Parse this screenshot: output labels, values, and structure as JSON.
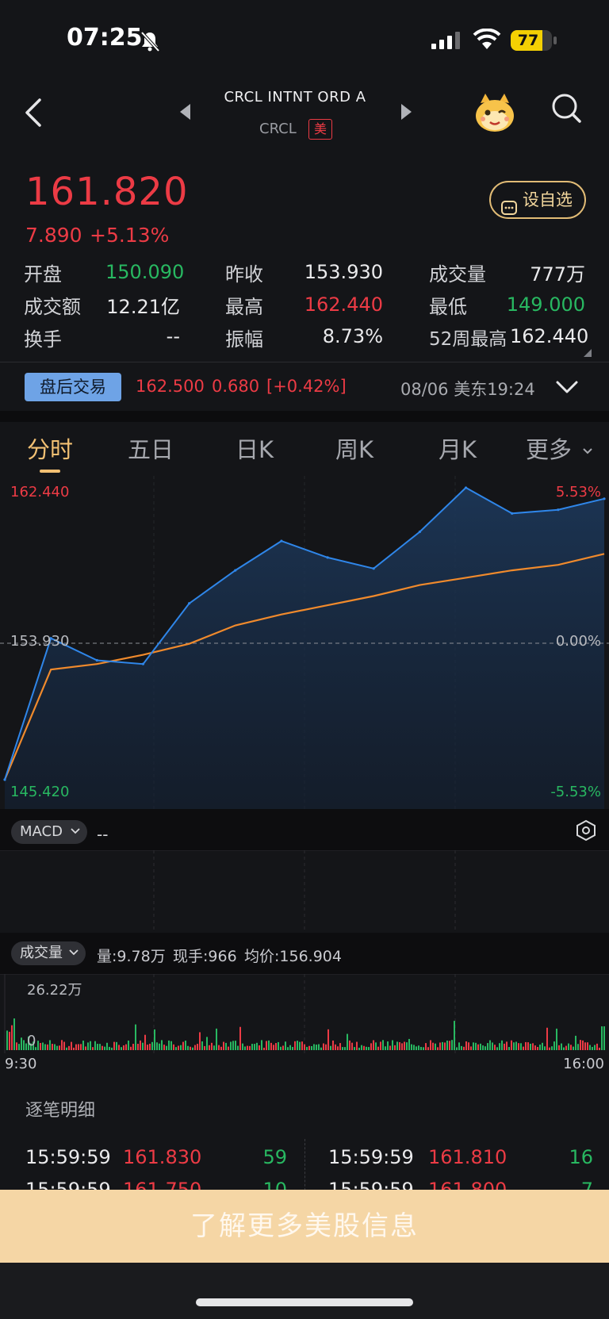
{
  "status_bar": {
    "time": "07:25",
    "battery": "77",
    "battery_level": 0.77
  },
  "header": {
    "name": "CRCL INTNT ORD A",
    "code": "CRCL",
    "market": "美"
  },
  "quote": {
    "price": "161.820",
    "change": "7.890",
    "change_pct": "+5.13%",
    "watchlist_label": "设自选",
    "stats": [
      {
        "label": "开盘",
        "value": "150.090"
      },
      {
        "label": "昨收",
        "value": "153.930"
      },
      {
        "label": "成交量",
        "value": "777万"
      },
      {
        "label": "成交额",
        "value": "12.21亿"
      },
      {
        "label": "最高",
        "value": "162.440"
      },
      {
        "label": "最低",
        "value": "149.000"
      },
      {
        "label": "换手",
        "value": "--"
      },
      {
        "label": "振幅",
        "value": "8.73%"
      },
      {
        "label": "52周最高",
        "value": "162.440"
      }
    ]
  },
  "after_hours": {
    "badge": "盘后交易",
    "price": "162.500",
    "change": "0.680",
    "change_pct": "[+0.42%]",
    "time": "08/06 美东19:24"
  },
  "tabs": [
    "分时",
    "五日",
    "日K",
    "周K",
    "月K",
    "更多"
  ],
  "chart": {
    "high_label": "162.440",
    "prev_close_label": "153.930",
    "low_label": "145.420",
    "high_pct": "5.53%",
    "zero_pct": "0.00%",
    "low_pct": "-5.53%",
    "colors": {
      "price_line": "#2f86e9",
      "avg_line": "#f08a2c",
      "up": "#ec3b45",
      "down": "#28b861"
    }
  },
  "chart_data": {
    "type": "line",
    "x": [
      "9:30",
      "10:00",
      "10:30",
      "11:00",
      "11:30",
      "12:00",
      "12:30",
      "13:00",
      "13:30",
      "14:00",
      "14:30",
      "15:00",
      "15:30",
      "16:00"
    ],
    "series": [
      {
        "values": [
          146.5,
          154.2,
          153.0,
          152.8,
          156.1,
          157.9,
          159.5,
          158.6,
          158.0,
          160.0,
          162.4,
          161.0,
          161.2,
          161.8
        ]
      },
      {
        "values": [
          146.5,
          152.5,
          152.8,
          153.3,
          153.9,
          154.9,
          155.5,
          156.0,
          156.5,
          157.1,
          157.5,
          157.9,
          158.2,
          158.8
        ]
      }
    ],
    "ylim": [
      145.42,
      162.44
    ],
    "prev_close": 153.93
  },
  "macd": {
    "label": "MACD",
    "value": "--"
  },
  "volume": {
    "label": "成交量",
    "qty": "量:9.78万",
    "hand": "现手:966",
    "avg": "均价:156.904",
    "max_label": "26.22万",
    "zero_label": "0",
    "start_time": "9:30",
    "end_time": "16:00"
  },
  "ticks": {
    "title": "逐笔明细",
    "rows": [
      {
        "time": "15:59:59",
        "price": "161.830",
        "qty": "59",
        "time2": "15:59:59",
        "price2": "161.810",
        "qty2": "16"
      },
      {
        "time": "15:59:59",
        "price": "161.750",
        "qty": "10",
        "time2": "15:59:59",
        "price2": "161.800",
        "qty2": "7"
      }
    ]
  },
  "banner": {
    "text": "了解更多美股信息"
  }
}
